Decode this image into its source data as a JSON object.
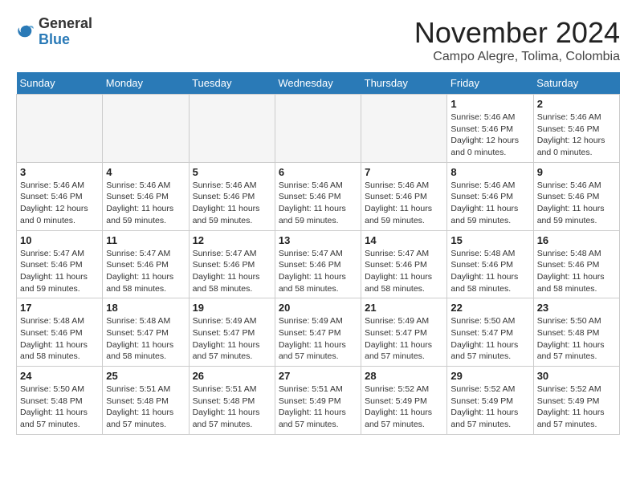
{
  "logo": {
    "general": "General",
    "blue": "Blue"
  },
  "title": "November 2024",
  "subtitle": "Campo Alegre, Tolima, Colombia",
  "weekdays": [
    "Sunday",
    "Monday",
    "Tuesday",
    "Wednesday",
    "Thursday",
    "Friday",
    "Saturday"
  ],
  "weeks": [
    [
      {
        "day": "",
        "info": ""
      },
      {
        "day": "",
        "info": ""
      },
      {
        "day": "",
        "info": ""
      },
      {
        "day": "",
        "info": ""
      },
      {
        "day": "",
        "info": ""
      },
      {
        "day": "1",
        "info": "Sunrise: 5:46 AM\nSunset: 5:46 PM\nDaylight: 12 hours and 0 minutes."
      },
      {
        "day": "2",
        "info": "Sunrise: 5:46 AM\nSunset: 5:46 PM\nDaylight: 12 hours and 0 minutes."
      }
    ],
    [
      {
        "day": "3",
        "info": "Sunrise: 5:46 AM\nSunset: 5:46 PM\nDaylight: 12 hours and 0 minutes."
      },
      {
        "day": "4",
        "info": "Sunrise: 5:46 AM\nSunset: 5:46 PM\nDaylight: 11 hours and 59 minutes."
      },
      {
        "day": "5",
        "info": "Sunrise: 5:46 AM\nSunset: 5:46 PM\nDaylight: 11 hours and 59 minutes."
      },
      {
        "day": "6",
        "info": "Sunrise: 5:46 AM\nSunset: 5:46 PM\nDaylight: 11 hours and 59 minutes."
      },
      {
        "day": "7",
        "info": "Sunrise: 5:46 AM\nSunset: 5:46 PM\nDaylight: 11 hours and 59 minutes."
      },
      {
        "day": "8",
        "info": "Sunrise: 5:46 AM\nSunset: 5:46 PM\nDaylight: 11 hours and 59 minutes."
      },
      {
        "day": "9",
        "info": "Sunrise: 5:46 AM\nSunset: 5:46 PM\nDaylight: 11 hours and 59 minutes."
      }
    ],
    [
      {
        "day": "10",
        "info": "Sunrise: 5:47 AM\nSunset: 5:46 PM\nDaylight: 11 hours and 59 minutes."
      },
      {
        "day": "11",
        "info": "Sunrise: 5:47 AM\nSunset: 5:46 PM\nDaylight: 11 hours and 58 minutes."
      },
      {
        "day": "12",
        "info": "Sunrise: 5:47 AM\nSunset: 5:46 PM\nDaylight: 11 hours and 58 minutes."
      },
      {
        "day": "13",
        "info": "Sunrise: 5:47 AM\nSunset: 5:46 PM\nDaylight: 11 hours and 58 minutes."
      },
      {
        "day": "14",
        "info": "Sunrise: 5:47 AM\nSunset: 5:46 PM\nDaylight: 11 hours and 58 minutes."
      },
      {
        "day": "15",
        "info": "Sunrise: 5:48 AM\nSunset: 5:46 PM\nDaylight: 11 hours and 58 minutes."
      },
      {
        "day": "16",
        "info": "Sunrise: 5:48 AM\nSunset: 5:46 PM\nDaylight: 11 hours and 58 minutes."
      }
    ],
    [
      {
        "day": "17",
        "info": "Sunrise: 5:48 AM\nSunset: 5:46 PM\nDaylight: 11 hours and 58 minutes."
      },
      {
        "day": "18",
        "info": "Sunrise: 5:48 AM\nSunset: 5:47 PM\nDaylight: 11 hours and 58 minutes."
      },
      {
        "day": "19",
        "info": "Sunrise: 5:49 AM\nSunset: 5:47 PM\nDaylight: 11 hours and 57 minutes."
      },
      {
        "day": "20",
        "info": "Sunrise: 5:49 AM\nSunset: 5:47 PM\nDaylight: 11 hours and 57 minutes."
      },
      {
        "day": "21",
        "info": "Sunrise: 5:49 AM\nSunset: 5:47 PM\nDaylight: 11 hours and 57 minutes."
      },
      {
        "day": "22",
        "info": "Sunrise: 5:50 AM\nSunset: 5:47 PM\nDaylight: 11 hours and 57 minutes."
      },
      {
        "day": "23",
        "info": "Sunrise: 5:50 AM\nSunset: 5:48 PM\nDaylight: 11 hours and 57 minutes."
      }
    ],
    [
      {
        "day": "24",
        "info": "Sunrise: 5:50 AM\nSunset: 5:48 PM\nDaylight: 11 hours and 57 minutes."
      },
      {
        "day": "25",
        "info": "Sunrise: 5:51 AM\nSunset: 5:48 PM\nDaylight: 11 hours and 57 minutes."
      },
      {
        "day": "26",
        "info": "Sunrise: 5:51 AM\nSunset: 5:48 PM\nDaylight: 11 hours and 57 minutes."
      },
      {
        "day": "27",
        "info": "Sunrise: 5:51 AM\nSunset: 5:49 PM\nDaylight: 11 hours and 57 minutes."
      },
      {
        "day": "28",
        "info": "Sunrise: 5:52 AM\nSunset: 5:49 PM\nDaylight: 11 hours and 57 minutes."
      },
      {
        "day": "29",
        "info": "Sunrise: 5:52 AM\nSunset: 5:49 PM\nDaylight: 11 hours and 57 minutes."
      },
      {
        "day": "30",
        "info": "Sunrise: 5:52 AM\nSunset: 5:49 PM\nDaylight: 11 hours and 57 minutes."
      }
    ]
  ]
}
